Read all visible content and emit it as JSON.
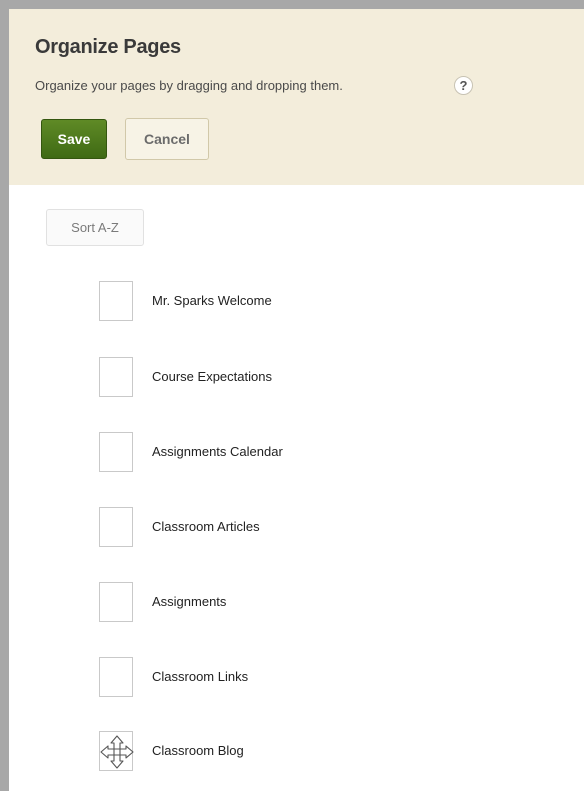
{
  "header": {
    "title": "Organize Pages",
    "subtitle": "Organize your pages by dragging and dropping them.",
    "help_icon": "?",
    "save_label": "Save",
    "cancel_label": "Cancel"
  },
  "toolbar": {
    "sort_label": "Sort A-Z"
  },
  "pages": [
    {
      "label": "Mr. Sparks Welcome"
    },
    {
      "label": "Course Expectations"
    },
    {
      "label": "Assignments Calendar"
    },
    {
      "label": "Classroom Articles"
    },
    {
      "label": "Assignments"
    },
    {
      "label": "Classroom Links"
    },
    {
      "label": "Classroom Blog",
      "handle_icon": "move-arrows-icon"
    }
  ],
  "colors": {
    "header_bg": "#f3eddb",
    "save_bg": "#4f7a1d",
    "frame_border": "#a8a8a8"
  }
}
